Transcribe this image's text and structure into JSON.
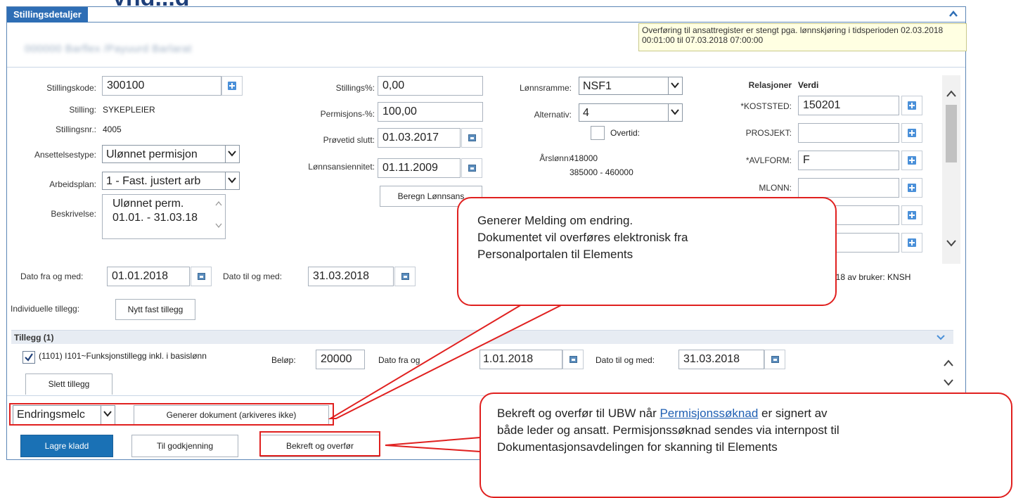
{
  "panel": {
    "title": "Stillingsdetaljer",
    "blurred_name": "000000 Barflex /Payuurd Barlarat",
    "notice": "Overføring til ansattregister er stengt pga. lønnskjøring i tidsperioden 02.03.2018 00:01:00 til 07.03.2018 07:00:00"
  },
  "left": {
    "stillingskode_label": "Stillingskode:",
    "stillingskode_value": "300100",
    "stilling_label": "Stilling:",
    "stilling_value": "SYKEPLEIER",
    "stillingsnr_label": "Stillingsnr.:",
    "stillingsnr_value": "4005",
    "ansettelsestype_label": "Ansettelsestype:",
    "ansettelsestype_value": "Ulønnet permisjon",
    "arbeidsplan_label": "Arbeidsplan:",
    "arbeidsplan_value": "1 - Fast. justert arb",
    "beskrivelse_label": "Beskrivelse:",
    "beskrivelse_line1": "Ulønnet perm.",
    "beskrivelse_line2": "01.01. - 31.03.18"
  },
  "middle": {
    "stillingspct_label": "Stillings%:",
    "stillingspct_value": "0,00",
    "permisjonspct_label": "Permisjons-%:",
    "permisjonspct_value": "100,00",
    "provetid_label": "Prøvetid slutt:",
    "provetid_value": "01.03.2017",
    "lonnsansiennitet_label": "Lønnsansiennitet:",
    "lonnsansiennitet_value": "01.11.2009",
    "beregn_button": "Beregn Lønnsans"
  },
  "right_mid": {
    "lonnsramme_label": "Lønnsramme:",
    "lonnsramme_value": "NSF1",
    "alternativ_label": "Alternativ:",
    "alternativ_value": "4",
    "overtid_label": "Overtid:",
    "arslonn_label": "Årslønn:",
    "arslonn_value": "418000",
    "arslonn_range": "385000 - 460000"
  },
  "relations": {
    "header_rel": "Relasjoner",
    "header_val": "Verdi",
    "rows": [
      {
        "label": "*KOSTSTED:",
        "value": "150201",
        "required": true
      },
      {
        "label": "PROSJEKT:",
        "value": "",
        "required": false
      },
      {
        "label": "*AVLFORM:",
        "value": "F",
        "required": true
      },
      {
        "label": "MLONN:",
        "value": "",
        "required": false
      },
      {
        "label": "",
        "value": "",
        "required": false
      },
      {
        "label": "",
        "value": "",
        "required": false
      }
    ]
  },
  "dates": {
    "fra_label": "Dato fra og med:",
    "fra_value": "01.01.2018",
    "til_label": "Dato til og med:",
    "til_value": "31.03.2018",
    "changed_by": "018 av bruker: KNSH"
  },
  "tillegg": {
    "individuelle_label": "Individuelle tillegg:",
    "nytt_button": "Nytt fast tillegg",
    "section_title": "Tillegg (1)",
    "item_label": "(1101) I101~Funksjonstillegg inkl. i basislønn",
    "belop_label": "Beløp:",
    "belop_value": "20000",
    "fra_label": "Dato fra og",
    "fra_value": "1.01.2018",
    "til_label": "Dato til og med:",
    "til_value": "31.03.2018",
    "slett_button": "Slett tillegg"
  },
  "bottom": {
    "doc_select": "Endringsmelc",
    "generer_button": "Generer dokument (arkiveres ikke)",
    "lagre_button": "Lagre kladd",
    "godkjenning_button": "Til godkjenning",
    "bekreft_button": "Bekreft og overfør"
  },
  "callouts": {
    "one_line1": "Generer Melding om endring.",
    "one_line2": "Dokumentet vil overføres elektronisk fra",
    "one_line3": "Personalportalen til Elements",
    "two_prefix": "Bekreft og overfør til UBW når ",
    "two_link": "Permisjonssøknad",
    "two_suffix": " er signert av",
    "two_line2": "både leder og ansatt. Permisjonssøknad sendes via internpost til",
    "two_line3": "Dokumentasjonsavdelingen for skanning til Elements"
  },
  "colors": {
    "header_blue": "#2e6eb5",
    "primary_button": "#1a71b5",
    "callout_red": "#e0201f",
    "notice_bg": "#ffffe2"
  }
}
